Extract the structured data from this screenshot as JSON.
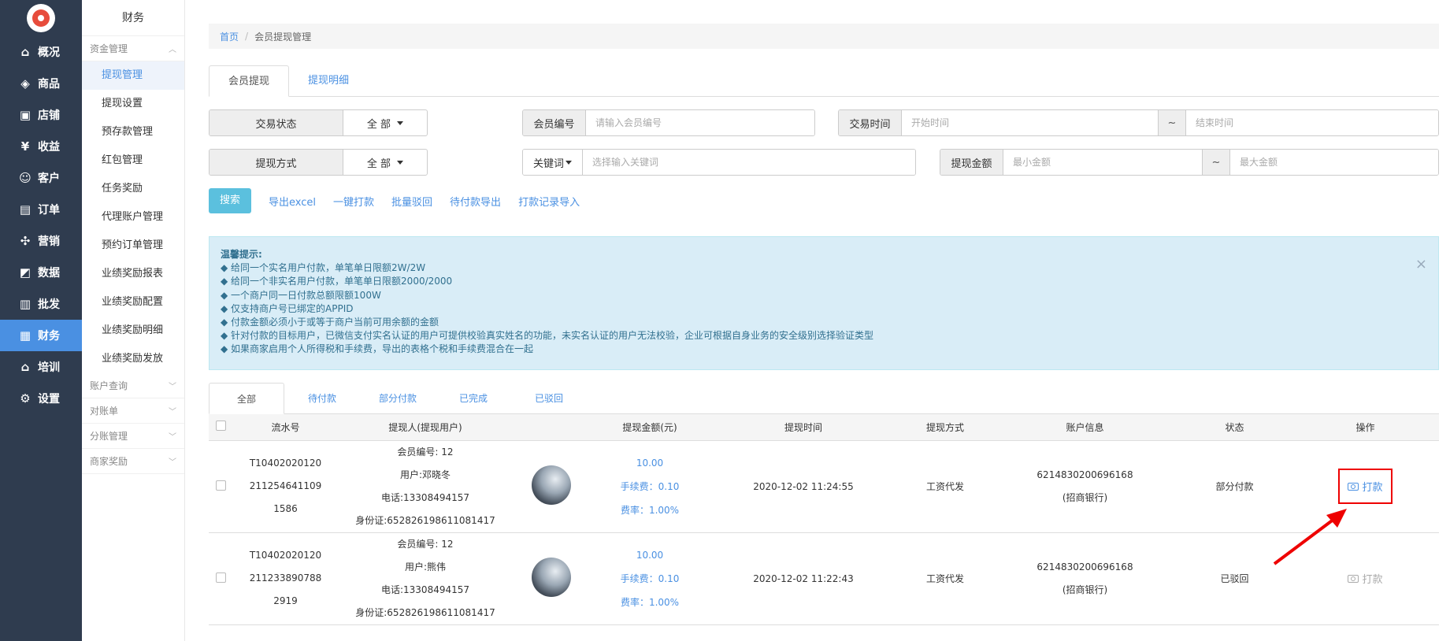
{
  "nav": {
    "items": [
      {
        "icon": "home-icon",
        "glyph": "⌂",
        "label": "概况"
      },
      {
        "icon": "tag-icon",
        "glyph": "◈",
        "label": "商品"
      },
      {
        "icon": "store-icon",
        "glyph": "▣",
        "label": "店铺"
      },
      {
        "icon": "yen-icon",
        "glyph": "¥",
        "label": "收益"
      },
      {
        "icon": "user-icon",
        "glyph": "☺",
        "label": "客户"
      },
      {
        "icon": "order-icon",
        "glyph": "▤",
        "label": "订单"
      },
      {
        "icon": "gift-icon",
        "glyph": "✣",
        "label": "营销"
      },
      {
        "icon": "chart-icon",
        "glyph": "◩",
        "label": "数据"
      },
      {
        "icon": "batch-icon",
        "glyph": "▥",
        "label": "批发"
      },
      {
        "icon": "finance-icon",
        "glyph": "▦",
        "label": "财务"
      },
      {
        "icon": "training-icon",
        "glyph": "⌂",
        "label": "培训"
      },
      {
        "icon": "gear-icon",
        "glyph": "⚙",
        "label": "设置"
      }
    ]
  },
  "submenu": {
    "title": "财务",
    "group1": "资金管理",
    "items": [
      "提现管理",
      "提现设置",
      "预存款管理",
      "红包管理",
      "任务奖励",
      "代理账户管理",
      "预约订单管理",
      "业绩奖励报表",
      "业绩奖励配置",
      "业绩奖励明细",
      "业绩奖励发放"
    ],
    "groups": [
      "账户查询",
      "对账单",
      "分账管理",
      "商家奖励"
    ]
  },
  "breadcrumb": {
    "home": "首页",
    "sep": "/",
    "current": "会员提现管理"
  },
  "tabs": [
    "会员提现",
    "提现明细"
  ],
  "filters": {
    "trade_status_label": "交易状态",
    "trade_status_value": "全 部",
    "member_no_label": "会员编号",
    "member_no_placeholder": "请输入会员编号",
    "trade_time_label": "交易时间",
    "start_placeholder": "开始时间",
    "tilde": "~",
    "end_placeholder": "结束时间",
    "method_label": "提现方式",
    "method_value": "全 部",
    "keyword_label": "关键词",
    "keyword_placeholder": "选择输入关键词",
    "amount_label": "提现金额",
    "min_placeholder": "最小金额",
    "max_placeholder": "最大金额"
  },
  "actions": {
    "search": "搜索",
    "links": [
      "导出excel",
      "一键打款",
      "批量驳回",
      "待付款导出",
      "打款记录导入"
    ]
  },
  "alert": {
    "title": "温馨提示:",
    "lines": [
      "◆ 给同一个实名用户付款，单笔单日限额2W/2W",
      "◆ 给同一个非实名用户付款，单笔单日限额2000/2000",
      "◆ 一个商户同一日付款总额限额100W",
      "◆ 仅支持商户号已绑定的APPID",
      "◆ 付款金额必须小于或等于商户当前可用余额的金额",
      "◆ 针对付款的目标用户，已微信支付实名认证的用户可提供校验真实姓名的功能，未实名认证的用户无法校验，企业可根据自身业务的安全级别选择验证类型",
      "◆ 如果商家启用个人所得税和手续费，导出的表格个税和手续费混合在一起"
    ],
    "close": "×"
  },
  "status_tabs": [
    "全部",
    "待付款",
    "部分付款",
    "已完成",
    "已驳回"
  ],
  "table": {
    "headers": [
      "流水号",
      "提现人(提现用户)",
      "提现金额(元)",
      "提现时间",
      "提现方式",
      "账户信息",
      "状态",
      "操作"
    ],
    "rows": [
      {
        "serial": [
          "T10402020120",
          "211254641109",
          "1586"
        ],
        "user": [
          "会员编号: 12",
          "用户:邓晓冬",
          "电话:13308494157",
          "身份证:652826198611081417"
        ],
        "amount": "10.00",
        "fee": "手续费：0.10",
        "rate": "费率：1.00%",
        "time": "2020-12-02 11:24:55",
        "method": "工资代发",
        "account": [
          "6214830200696168",
          "(招商银行)"
        ],
        "status": "部分付款",
        "op": "打款"
      },
      {
        "serial": [
          "T10402020120",
          "211233890788",
          "2919"
        ],
        "user": [
          "会员编号: 12",
          "用户:熊伟",
          "电话:13308494157",
          "身份证:652826198611081417"
        ],
        "amount": "10.00",
        "fee": "手续费：0.10",
        "rate": "费率：1.00%",
        "time": "2020-12-02 11:22:43",
        "method": "工资代发",
        "account": [
          "6214830200696168",
          "(招商银行)"
        ],
        "status": "已驳回",
        "op": "打款"
      }
    ]
  },
  "colors": {
    "nav_bg": "#2f3c4f",
    "nav_active": "#4a90e2",
    "link": "#4a90e2",
    "alert_bg": "#d9edf7",
    "highlight": "#ee0000"
  }
}
